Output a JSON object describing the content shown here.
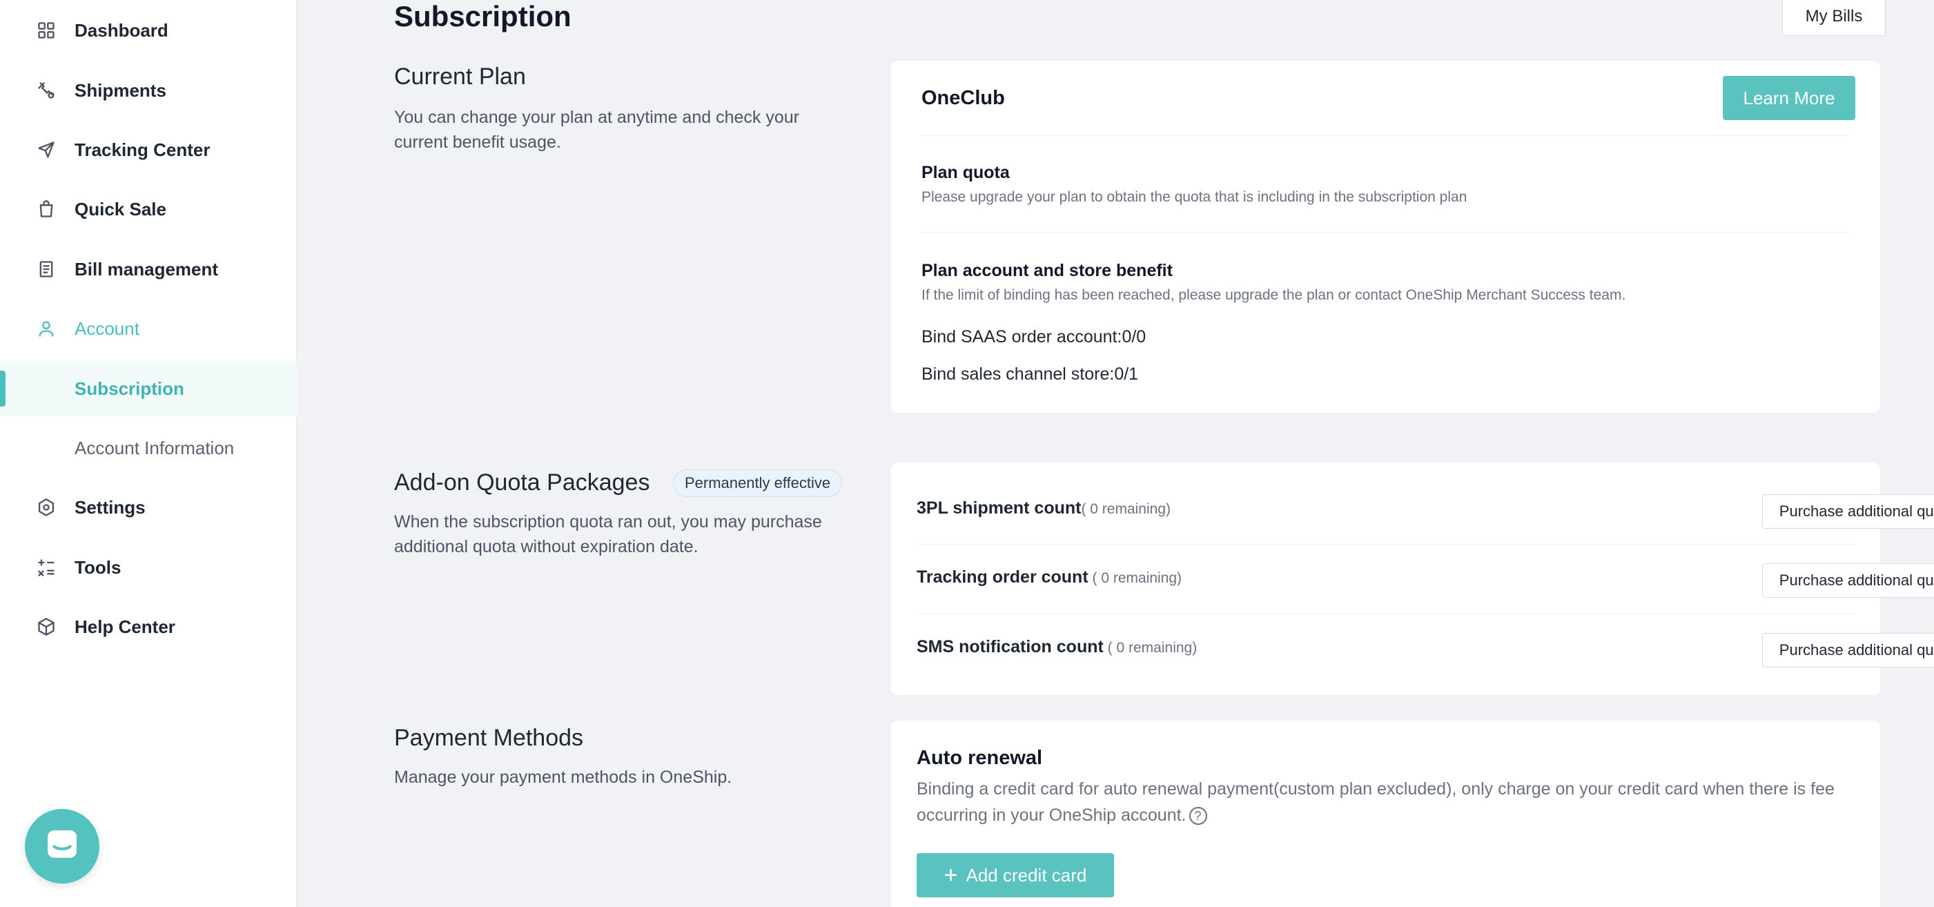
{
  "sidebar": {
    "items": [
      {
        "label": "Dashboard",
        "icon": "dashboard-icon"
      },
      {
        "label": "Shipments",
        "icon": "shipments-icon"
      },
      {
        "label": "Tracking Center",
        "icon": "send-icon"
      },
      {
        "label": "Quick Sale",
        "icon": "shopping-bag-icon"
      },
      {
        "label": "Bill management",
        "icon": "bill-icon"
      },
      {
        "label": "Account",
        "icon": "user-icon"
      },
      {
        "label": "Subscription"
      },
      {
        "label": "Account Information"
      },
      {
        "label": "Settings",
        "icon": "gear-icon"
      },
      {
        "label": "Tools",
        "icon": "tools-icon"
      },
      {
        "label": "Help Center",
        "icon": "box-icon"
      }
    ],
    "accent": "#4bbfbd"
  },
  "header": {
    "title": "Subscription",
    "my_bills_label": "My Bills"
  },
  "current_plan": {
    "title": "Current Plan",
    "description": "You can change your plan at anytime and check your current benefit usage.",
    "plan_name": "OneClub",
    "learn_more_label": "Learn More",
    "quota_title": "Plan quota",
    "quota_desc": "Please upgrade your plan to obtain the quota that is including in the subscription plan",
    "benefit_title": "Plan account and store benefit",
    "benefit_desc": "If the limit of binding has been reached, please upgrade the plan or contact OneShip Merchant Success team.",
    "bind_saas": "Bind SAAS order account:0/0",
    "bind_store": "Bind sales channel store:0/1"
  },
  "addon": {
    "title": "Add-on Quota Packages",
    "badge": "Permanently effective",
    "description": "When the subscription quota ran out, you may purchase additional quota without expiration date.",
    "rows": [
      {
        "label": "3PL shipment count",
        "remaining": "( 0 remaining)",
        "button": "Purchase additional quota"
      },
      {
        "label": "Tracking order count",
        "remaining": " ( 0 remaining)",
        "button": "Purchase additional quota"
      },
      {
        "label": "SMS notification count",
        "remaining": " ( 0 remaining)",
        "button": "Purchase additional quota"
      }
    ]
  },
  "payment": {
    "title": "Payment Methods",
    "description": "Manage your payment methods in OneShip.",
    "auto_renewal_title": "Auto renewal",
    "auto_renewal_desc": "Binding a credit card for auto renewal payment(custom plan excluded), only charge on your credit card when there is fee occurring in your OneShip account.",
    "add_card_label": "Add credit card"
  }
}
